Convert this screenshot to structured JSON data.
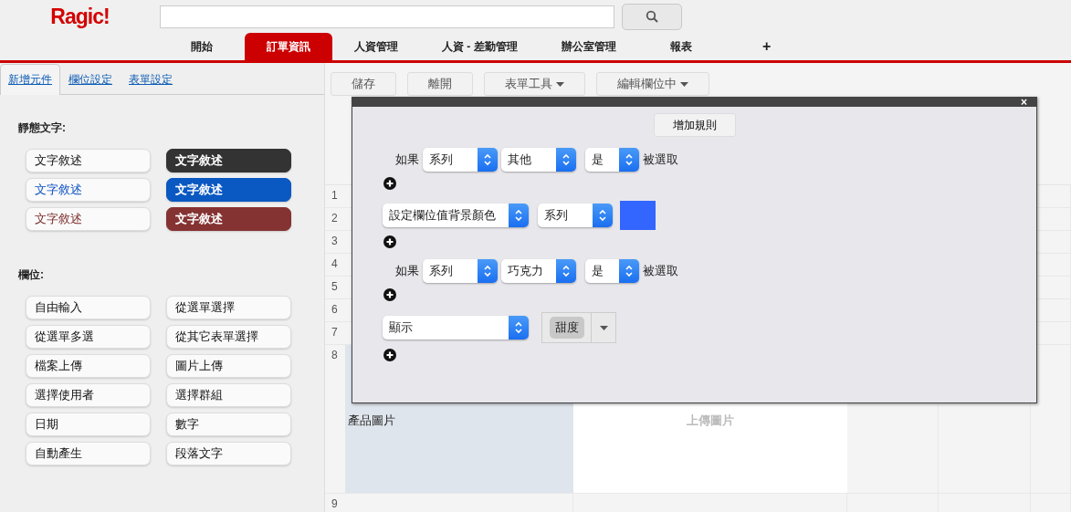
{
  "header": {
    "logo": "Ragic!"
  },
  "nav_tabs": [
    {
      "label": "開始",
      "selected": false
    },
    {
      "label": "訂單資訊",
      "selected": true
    },
    {
      "label": "人資管理",
      "selected": false
    },
    {
      "label": "人資 - 差勤管理",
      "selected": false
    },
    {
      "label": "辦公室管理",
      "selected": false
    },
    {
      "label": "報表",
      "selected": false
    }
  ],
  "add_tab": "+",
  "side_tabs": [
    {
      "label": "新增元件",
      "selected": true
    },
    {
      "label": "欄位設定",
      "selected": false
    },
    {
      "label": "表單設定",
      "selected": false
    }
  ],
  "static_text": {
    "heading": "靜態文字:",
    "items": [
      {
        "label": "文字敘述",
        "kind": "outline",
        "color": "#111111"
      },
      {
        "label": "文字敘述",
        "kind": "filled",
        "color": "#333333"
      },
      {
        "label": "文字敘述",
        "kind": "outline",
        "color": "#0a4fc0"
      },
      {
        "label": "文字敘述",
        "kind": "filled",
        "color": "#0a58c2"
      },
      {
        "label": "文字敘述",
        "kind": "outline",
        "color": "#7a2a2a"
      },
      {
        "label": "文字敘述",
        "kind": "filled",
        "color": "#853232"
      }
    ]
  },
  "fields": {
    "heading": "欄位:",
    "items": [
      "自由輸入",
      "從選單選擇",
      "從選單多選",
      "從其它表單選擇",
      "檔案上傳",
      "圖片上傳",
      "選擇使用者",
      "選擇群組",
      "日期",
      "數字",
      "自動產生",
      "段落文字"
    ]
  },
  "toolbar": [
    {
      "label": "儲存",
      "has_menu": false
    },
    {
      "label": "離開",
      "has_menu": false
    },
    {
      "label": "表單工具",
      "has_menu": true
    },
    {
      "label": "編輯欄位中",
      "has_menu": true
    }
  ],
  "sheet": {
    "rows": [
      {
        "number": "1"
      },
      {
        "number": "2"
      },
      {
        "number": "3"
      },
      {
        "number": "4"
      },
      {
        "number": "5"
      },
      {
        "number": "6"
      },
      {
        "number": "7"
      },
      {
        "number": "8",
        "label": "產品圖片",
        "value": "上傳圖片"
      },
      {
        "number": "9"
      }
    ]
  },
  "dialog": {
    "close": "×",
    "add_rule": "增加規則",
    "rules": [
      {
        "kind": "condition",
        "prefix": "如果",
        "selects": [
          "系列",
          "其他",
          "是"
        ],
        "suffix": "被選取"
      },
      {
        "kind": "action",
        "selects": [
          "設定欄位值背景顏色",
          "系列"
        ],
        "color": "#3366ff"
      },
      {
        "kind": "condition",
        "prefix": "如果",
        "selects": [
          "系列",
          "巧克力",
          "是"
        ],
        "suffix": "被選取"
      },
      {
        "kind": "action",
        "selects": [
          "顯示"
        ],
        "tags": [
          "甜度"
        ]
      }
    ]
  }
}
